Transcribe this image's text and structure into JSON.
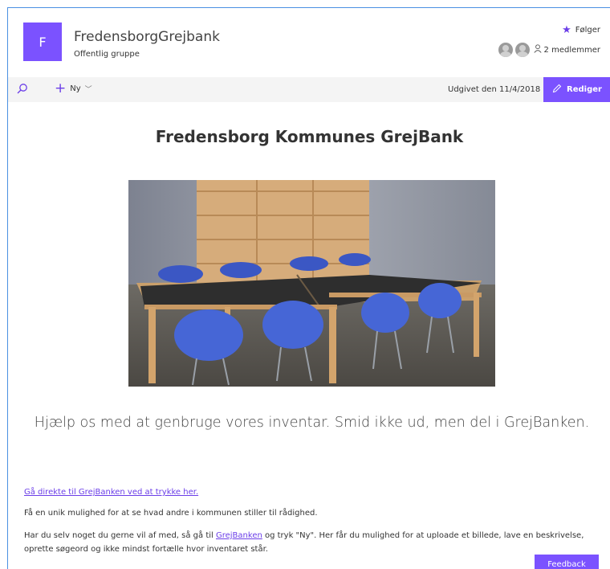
{
  "header": {
    "avatar_letter": "F",
    "site_title": "FredensborgGrejbank",
    "site_subtitle": "Offentlig gruppe",
    "follow_label": "Følger",
    "members_label": "2 medlemmer"
  },
  "commandbar": {
    "new_label": "Ny",
    "published_label": "Udgivet den 11/4/2018",
    "edit_label": "Rediger"
  },
  "content": {
    "heading": "Fredensborg Kommunes GrejBank",
    "tagline": "Hjælp os med at genbruge vores inventar. Smid ikke ud, men del i GrejBanken.",
    "link_direct": "Gå direkte til GrejBanken ved at trykke her.",
    "paragraph1": "Få en unik mulighed for at se hvad andre i kommunen stiller til rådighed.",
    "paragraph2_part1": "Har du selv noget du gerne vil af med, så gå til ",
    "paragraph2_link": "GrejBanken",
    "paragraph2_part2": " og tryk \"Ny\". Her får du mulighed for at uploade et billede, lave en beskrivelse, oprette søgeord og ikke mindst fortælle hvor inventaret står."
  },
  "feedback_label": "Feedback",
  "colors": {
    "accent": "#7b52ff",
    "link": "#6b3ee8",
    "command_bar": "#f4f4f4"
  }
}
